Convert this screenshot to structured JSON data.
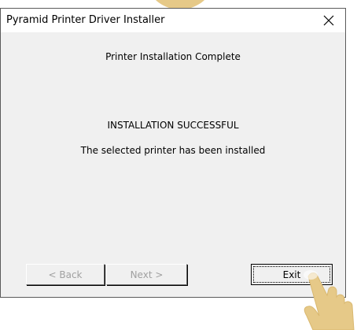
{
  "window": {
    "title": "Pyramid Printer Driver Installer",
    "close_symbol": "✕"
  },
  "content": {
    "heading": "Printer Installation Complete",
    "status": "INSTALLATION SUCCESSFUL",
    "message": "The selected printer has been installed"
  },
  "buttons": {
    "back_label": "< Back",
    "next_label": "Next >",
    "exit_label": "Exit"
  },
  "icons": {
    "close": "close-icon",
    "pointer": "hand-pointer-icon"
  },
  "colors": {
    "dialog_bg": "#f0f0f0",
    "disabled_text": "#a0a0a0",
    "pointer_hand": "#e6c988"
  }
}
